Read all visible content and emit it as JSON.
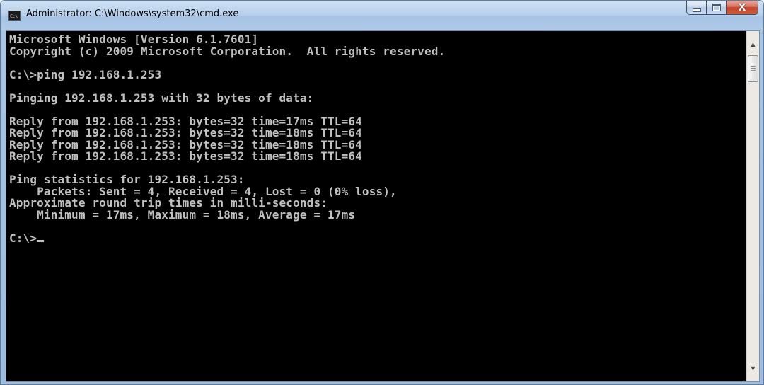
{
  "window": {
    "title": "Administrator: C:\\Windows\\system32\\cmd.exe",
    "icon": "cmd-icon",
    "icon_text": "C:\\",
    "controls": {
      "minimize": "minimize-icon",
      "maximize": "maximize-icon",
      "close_label": "X"
    }
  },
  "console": {
    "foreground": "#c0c0c0",
    "background": "#000000",
    "lines": [
      "Microsoft Windows [Version 6.1.7601]",
      "Copyright (c) 2009 Microsoft Corporation.  All rights reserved.",
      "",
      "C:\\>ping 192.168.1.253",
      "",
      "Pinging 192.168.1.253 with 32 bytes of data:",
      "",
      "Reply from 192.168.1.253: bytes=32 time=17ms TTL=64",
      "Reply from 192.168.1.253: bytes=32 time=18ms TTL=64",
      "Reply from 192.168.1.253: bytes=32 time=18ms TTL=64",
      "Reply from 192.168.1.253: bytes=32 time=18ms TTL=64",
      "",
      "Ping statistics for 192.168.1.253:",
      "    Packets: Sent = 4, Received = 4, Lost = 0 (0% loss),",
      "Approximate round trip times in milli-seconds:",
      "    Minimum = 17ms, Maximum = 18ms, Average = 17ms",
      "",
      "C:\\>"
    ]
  },
  "scrollbar": {
    "up_icon": "scroll-up-arrow-icon",
    "down_icon": "scroll-down-arrow-icon",
    "up_glyph": "▲",
    "down_glyph": "▼"
  }
}
